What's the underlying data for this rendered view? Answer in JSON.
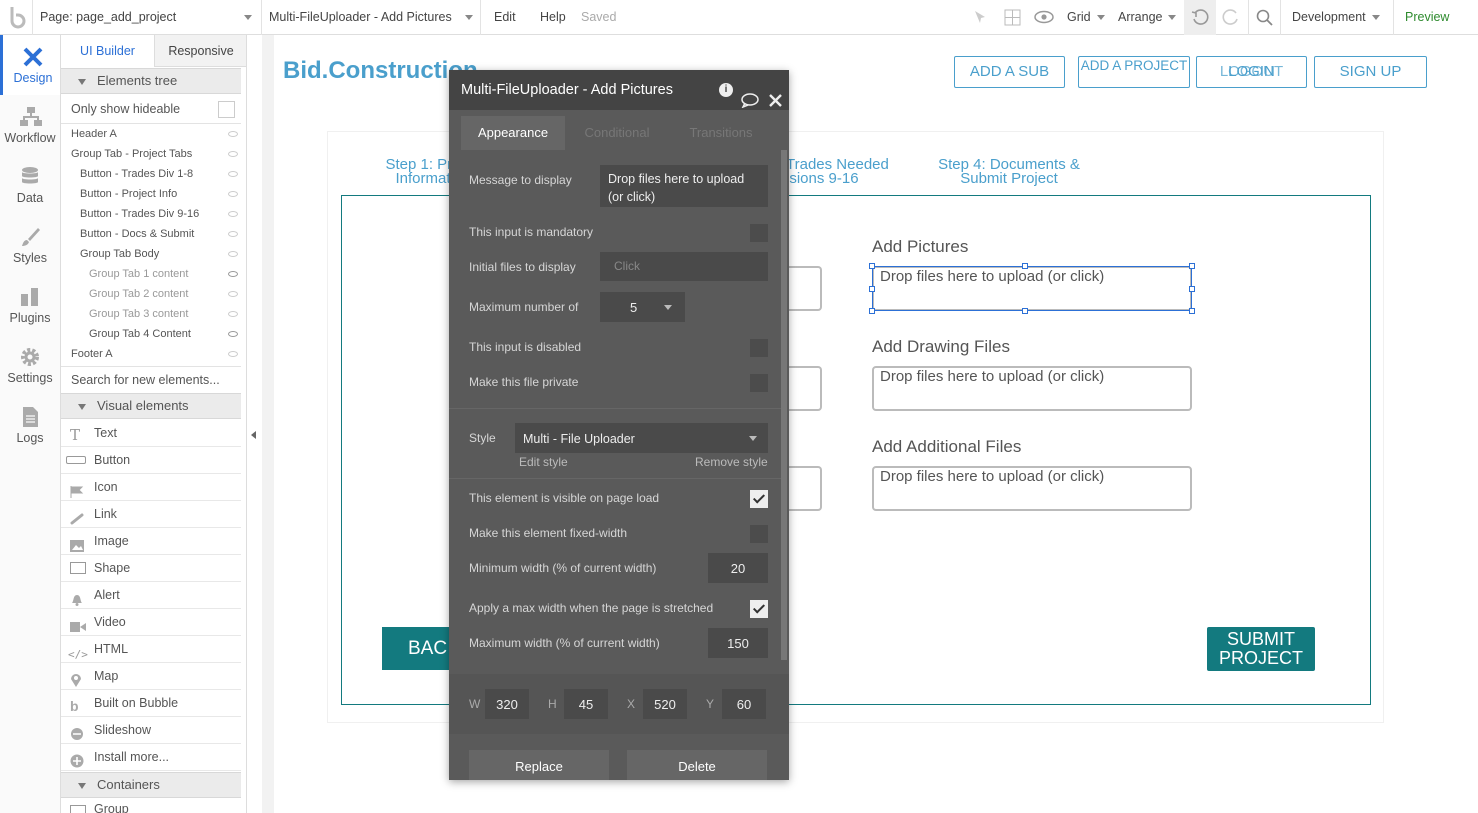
{
  "topbar": {
    "page_selector": "Page: page_add_project",
    "element_selector": "Multi-FileUploader - Add Pictures",
    "edit": "Edit",
    "help": "Help",
    "saved": "Saved",
    "grid": "Grid",
    "arrange": "Arrange",
    "version": "Development",
    "preview": "Preview"
  },
  "leftnav": {
    "items": [
      {
        "label": "Design",
        "icon": "design-icon"
      },
      {
        "label": "Workflow",
        "icon": "workflow-icon"
      },
      {
        "label": "Data",
        "icon": "data-icon"
      },
      {
        "label": "Styles",
        "icon": "styles-icon"
      },
      {
        "label": "Plugins",
        "icon": "plugins-icon"
      },
      {
        "label": "Settings",
        "icon": "settings-icon"
      },
      {
        "label": "Logs",
        "icon": "logs-icon"
      }
    ]
  },
  "panel": {
    "tabs": [
      "UI Builder",
      "Responsive"
    ],
    "elements_tree_title": "Elements tree",
    "only_show_hideable": "Only show hideable",
    "tree": [
      "Header A",
      "Group Tab - Project Tabs",
      "Button - Trades Div 1-8",
      "Button - Project Info",
      "Button - Trades Div 9-16",
      "Button - Docs & Submit",
      "Group Tab Body",
      "Group Tab 1 content",
      "Group Tab 2 content",
      "Group Tab 3 content",
      "Group Tab 4 Content",
      "Footer A"
    ],
    "search_placeholder": "Search for new elements...",
    "visual_elements_title": "Visual elements",
    "visual_elements": [
      "Text",
      "Button",
      "Icon",
      "Link",
      "Image",
      "Shape",
      "Alert",
      "Video",
      "HTML",
      "Map",
      "Built on Bubble",
      "Slideshow",
      "Install more..."
    ],
    "containers_title": "Containers",
    "containers_first": "Group"
  },
  "page": {
    "logo": "Bid.Construction",
    "nav_buttons": [
      "ADD A SUB",
      "ADD A PROJECT",
      "LOGIN",
      "LOGOUT",
      "SIGN UP"
    ],
    "steps": {
      "step1_line1": "Step 1: Pro",
      "step1_line2": "Informat",
      "step3_line1": "Trades Needed",
      "step3_line2": "isions 9-16",
      "step4_line1": "Step 4: Documents &",
      "step4_line2": "Submit Project"
    },
    "fields": [
      {
        "label": "Add Pictures",
        "placeholder": "Drop files here to upload (or click)"
      },
      {
        "label": "Add Drawing Files",
        "placeholder": "Drop files here to upload (or click)"
      },
      {
        "label": "Add Additional Files",
        "placeholder": "Drop files here to upload (or click)"
      }
    ],
    "back_button": "BAC",
    "submit_line1": "SUBMIT",
    "submit_line2": "PROJECT"
  },
  "dialog": {
    "title": "Multi-FileUploader - Add Pictures",
    "tabs": [
      "Appearance",
      "Conditional",
      "Transitions"
    ],
    "message_label": "Message to display",
    "message_value": "Drop files here to upload (or click)",
    "mandatory_label": "This input is mandatory",
    "initial_files_label": "Initial files to display",
    "initial_files_placeholder": "Click",
    "max_number_label": "Maximum number of",
    "max_number_value": "5",
    "disabled_label": "This input is disabled",
    "private_label": "Make this file private",
    "style_label": "Style",
    "style_value": "Multi - File Uploader",
    "edit_style": "Edit style",
    "remove_style": "Remove style",
    "visible_label": "This element is visible on page load",
    "fixed_width_label": "Make this element fixed-width",
    "min_width_label": "Minimum width (% of current width)",
    "min_width_value": "20",
    "apply_max_label": "Apply a max width when the page is stretched",
    "max_width_label": "Maximum width (% of current width)",
    "max_width_value": "150",
    "w_label": "W",
    "w_value": "320",
    "h_label": "H",
    "h_value": "45",
    "x_label": "X",
    "x_value": "520",
    "y_label": "Y",
    "y_value": "60",
    "replace": "Replace",
    "delete": "Delete",
    "checkboxes": {
      "mandatory": false,
      "disabled": false,
      "private": false,
      "visible": true,
      "fixed_width": false,
      "apply_max": true
    }
  },
  "colors": {
    "accent": "#4a9fcc",
    "teal": "#137a7f",
    "dialog_bg": "#5a5a5a",
    "dialog_header": "#444444",
    "preview": "#2e8b2e"
  }
}
